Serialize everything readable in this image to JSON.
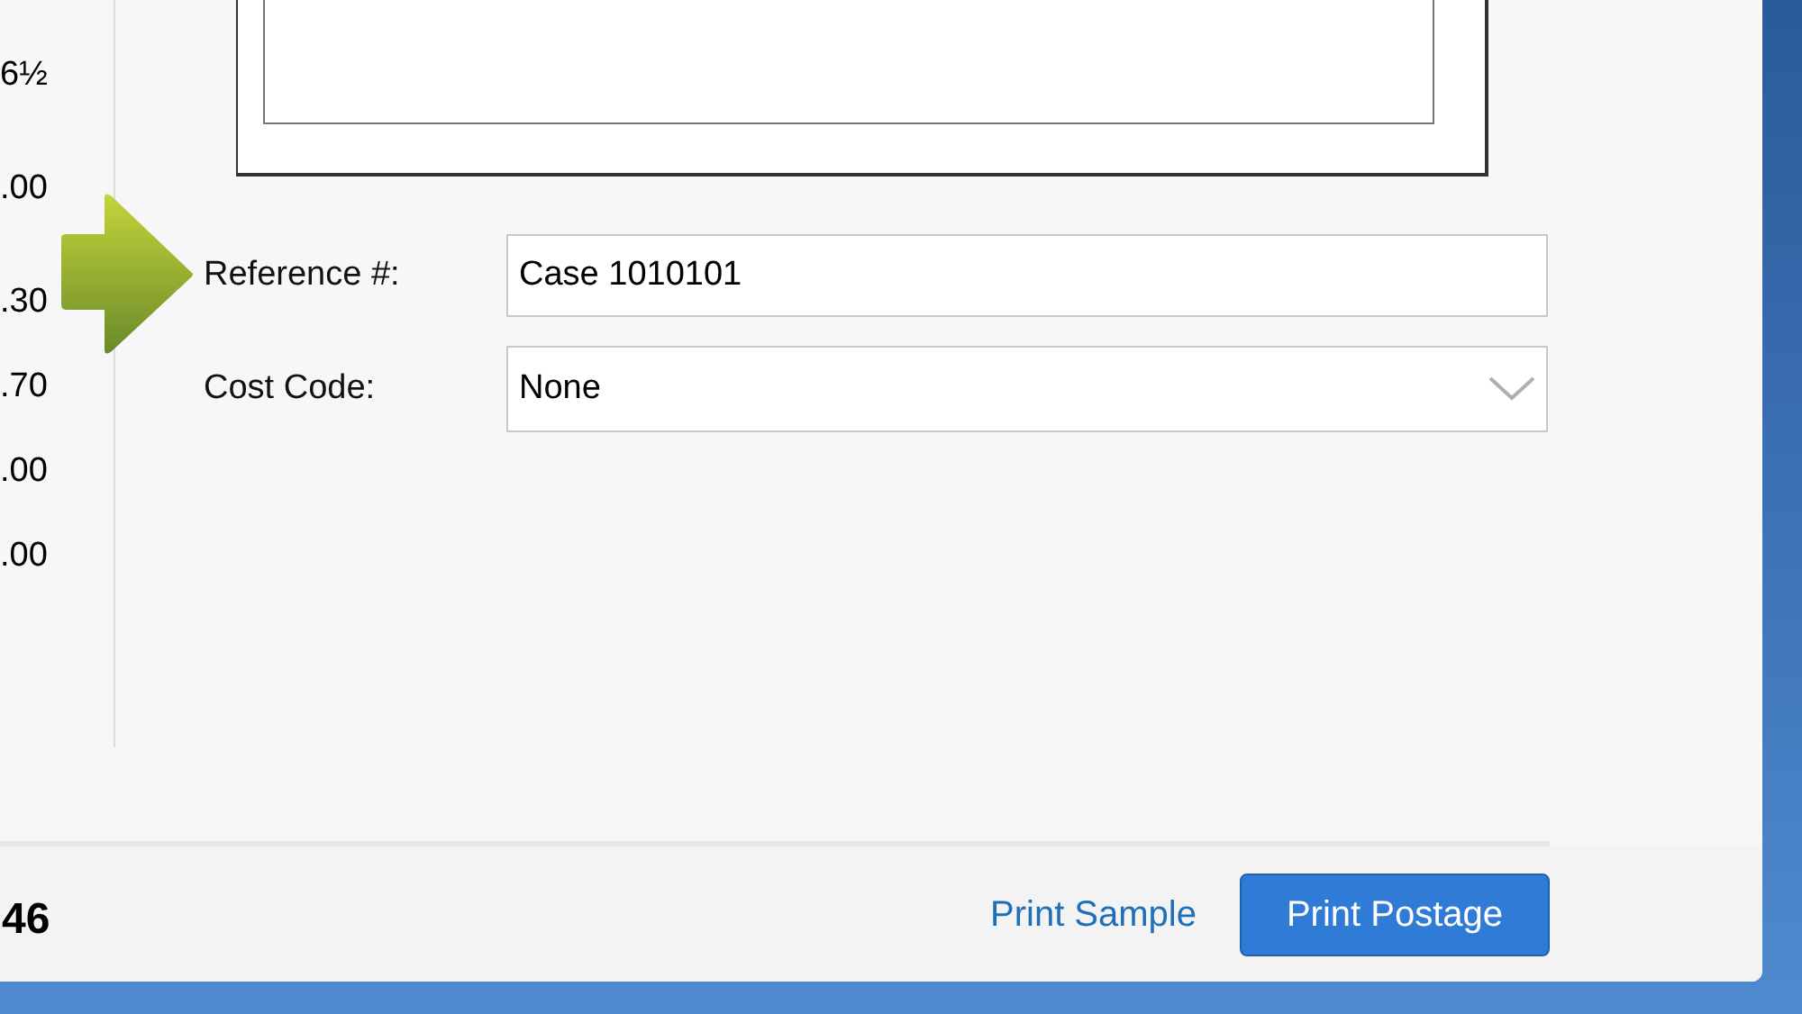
{
  "summary_column": {
    "values": [
      "6½",
      ".00",
      ".30",
      ".70",
      ".00",
      ".00"
    ]
  },
  "form": {
    "fields": [
      {
        "kind": "text",
        "label": "Reference #:",
        "value": "Case 1010101"
      },
      {
        "kind": "select",
        "label": "Cost Code:",
        "value": "None"
      }
    ]
  },
  "footer": {
    "total": "46",
    "link": "Print Sample",
    "button": "Print Postage"
  }
}
